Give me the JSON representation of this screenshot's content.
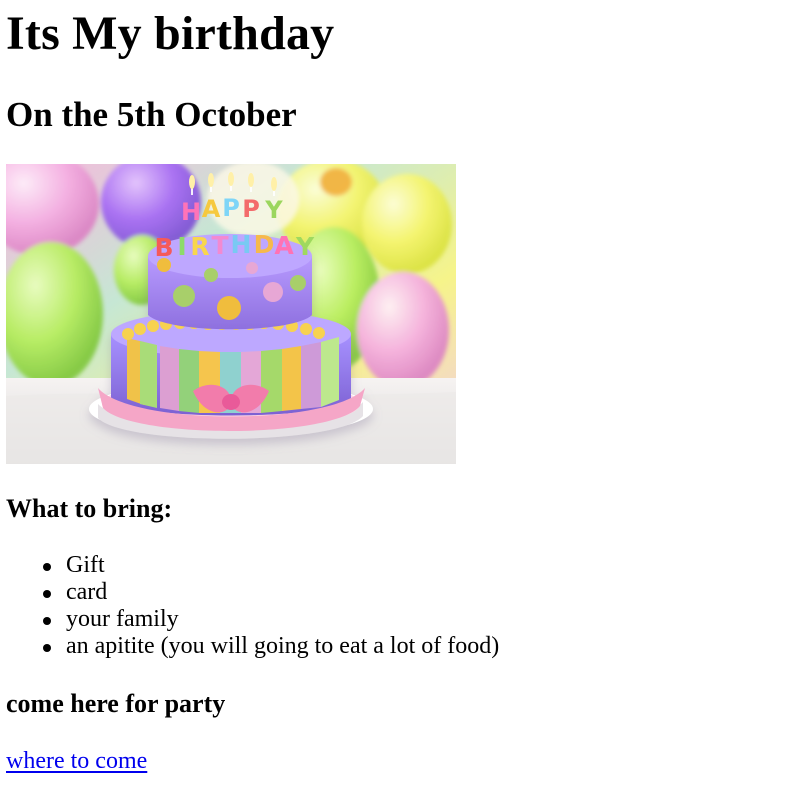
{
  "page": {
    "title": "Its My birthday",
    "subtitle": "On the 5th October"
  },
  "image": {
    "description_icon": "birthday-cake-photo",
    "cake_lettering": "HAPPY BIRTHDAY"
  },
  "bring": {
    "heading": "What to bring:",
    "items": [
      "Gift",
      "card",
      "your family",
      "an apitite (you will going to eat a lot of food)"
    ]
  },
  "party": {
    "heading": "come here for party",
    "link_text": "where to come",
    "link_color": "#0000EE"
  }
}
